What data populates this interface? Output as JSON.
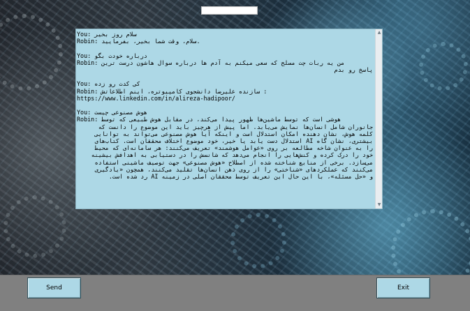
{
  "window": {
    "title": ""
  },
  "chat": {
    "lines": [
      {
        "text": "You: سلام روز بخیر",
        "dir": "ltr"
      },
      {
        "text": "Robin: سلام، وقت شما بخیر، بفرمایید.",
        "dir": "ltr"
      },
      {
        "text": "",
        "dir": "gap"
      },
      {
        "text": "You: درباره خودت بگو",
        "dir": "ltr"
      },
      {
        "text": "Robin: من یه ربات چت مسلح که سعی میکنم به آدم ها درباره سوال هاشون درست ترین",
        "dir": "ltr"
      },
      {
        "text": "پاسخ رو بدم",
        "dir": "rtl"
      },
      {
        "text": "",
        "dir": "gap"
      },
      {
        "text": "You: کی کدت رو زده",
        "dir": "ltr"
      },
      {
        "text": "Robin: سازنده علیرضا دانشجوی کامپیوتره، اینم اطلاعاتش :",
        "dir": "ltr"
      },
      {
        "text": "https://www.linkedin.com/in/alireza-hadipoor/",
        "dir": "ltr"
      },
      {
        "text": "",
        "dir": "gap"
      },
      {
        "text": "You: هوش مصنوعی چیست",
        "dir": "ltr"
      },
      {
        "text": "Robin: هوشی است که توسط ماشین‌ها ظهور پیدا می‌کند، در مقابل هوش طبیعی که توسط",
        "dir": "ltr"
      },
      {
        "text": "جانوران شامل انسان‌ها نمایش می‌یابد. اما پیش از هرچیز باید این موضوع را دانست که",
        "dir": "rtl"
      },
      {
        "text": "کلمه هوش، نشان دهنده امکان استدلال است و اینکه آیا هوش مصنوعی می‌تواند به توانایی",
        "dir": "rtl"
      },
      {
        "text": "بیشتری، نشان گاه AI استدلال دست یابد یا خیر، خود موضوع اختلاف محققان است. کتاب‌های",
        "dir": "rtl"
      },
      {
        "text": "را به عنوان شاخه مطالعه بر روی «عوامل هوشمند» تعریف می‌کنند: هر سامانه‌ای که محیط",
        "dir": "rtl"
      },
      {
        "text": "خود را درک کرده و کنش‌هایی را انجام می‌دهد که شانسش را در دستیابی به اهدافش بیشینه",
        "dir": "rtl"
      },
      {
        "text": "می‌سازد. برخی از منابع شناخته شده از اصطلاح «هوش مصنوعی» جهت توصیف ماشینی استفاده",
        "dir": "rtl"
      },
      {
        "text": "می‌کنند که عملکردهای «شناختی» را از روی ذهن انسان‌ها تقلید می‌کنند، همچون «یادگیری",
        "dir": "rtl"
      },
      {
        "text": "و «حل مسئله»، با این حال این تعریف توسط محققان اصلی در زمینه AI رد شده است.",
        "dir": "rtl"
      }
    ]
  },
  "buttons": {
    "send_label": "Send",
    "exit_label": "Exit"
  },
  "colors": {
    "panel": "#add8e6",
    "bottom_bar": "#808080",
    "button": "#add8e6"
  }
}
